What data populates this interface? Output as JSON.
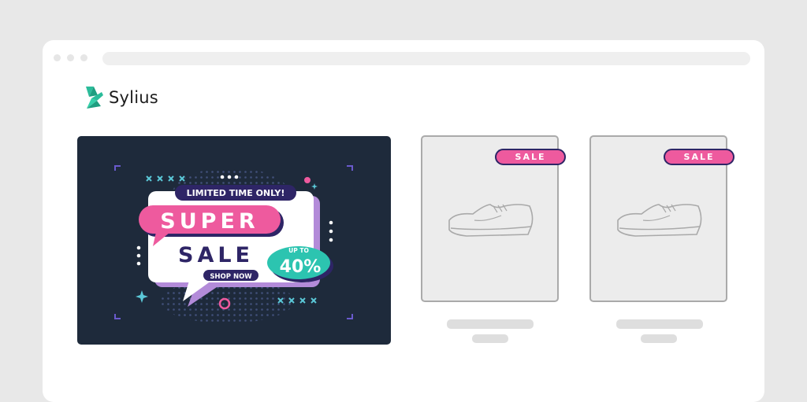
{
  "browser": {
    "window_controls": [
      "close-dot",
      "minimize-dot",
      "maximize-dot"
    ]
  },
  "brand": {
    "name": "Sylius",
    "logo_icon": "sylius-logo-icon",
    "logo_color": "#2bbc9a"
  },
  "banner": {
    "tagline": "LIMITED TIME ONLY!",
    "headline_1": "SUPER",
    "headline_2": "SALE",
    "cta": "SHOP NOW",
    "discount_prefix": "UP TO",
    "discount_value": "40%",
    "colors": {
      "background": "#1e2a3b",
      "pink": "#ee5a9e",
      "purple": "#2e2566",
      "teal": "#2cc4b0",
      "lavender": "#b38bd9"
    }
  },
  "products": [
    {
      "badge": "SALE",
      "image_icon": "sneaker-icon"
    },
    {
      "badge": "SALE",
      "image_icon": "sneaker-icon"
    }
  ]
}
